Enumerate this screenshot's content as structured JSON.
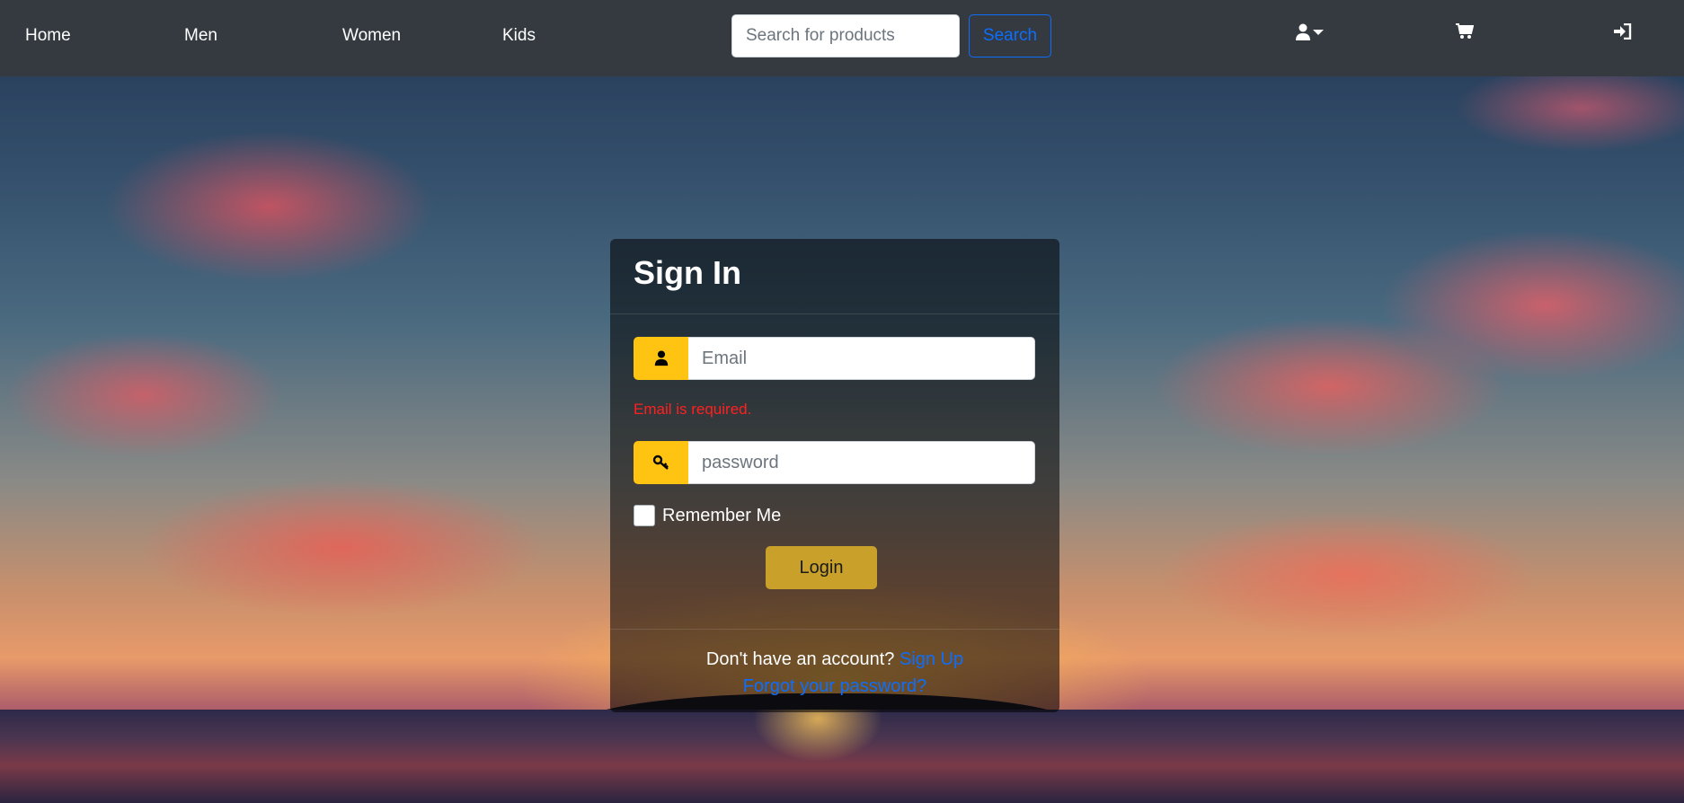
{
  "nav": {
    "links": [
      {
        "label": "Home"
      },
      {
        "label": "Men"
      },
      {
        "label": "Women"
      },
      {
        "label": "Kids"
      }
    ],
    "search": {
      "placeholder": "Search for products",
      "button_label": "Search"
    },
    "icons": [
      "user-icon",
      "caret-down-icon",
      "cart-icon",
      "sign-in-icon"
    ]
  },
  "signin": {
    "title": "Sign In",
    "email_placeholder": "Email",
    "email_error": "Email is required.",
    "password_placeholder": "password",
    "remember_label": "Remember Me",
    "login_label": "Login",
    "footer_prompt": "Don't have an account?",
    "signup_label": "Sign Up",
    "forgot_label": "Forgot your password?"
  },
  "colors": {
    "navbar_bg": "#343a40",
    "accent_yellow": "#ffc312",
    "link_blue": "#0d6efd",
    "error_red": "#ff2020"
  }
}
